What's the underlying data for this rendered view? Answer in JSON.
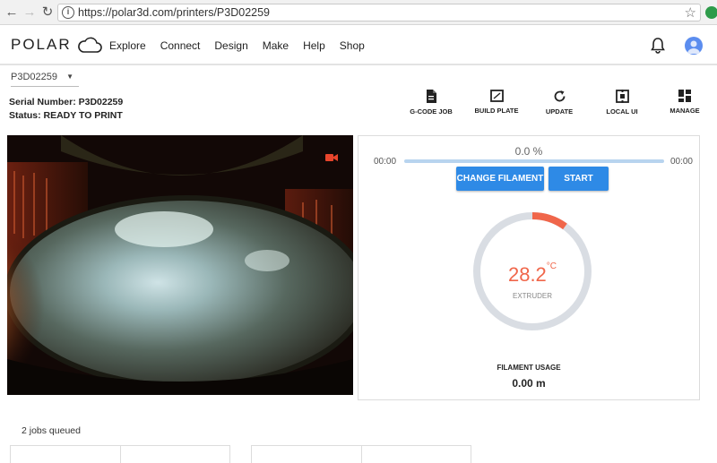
{
  "browser": {
    "url": "https://polar3d.com/printers/P3D02259",
    "back_icon": "arrow-left-icon",
    "forward_icon": "arrow-right-icon",
    "reload_icon": "reload-icon"
  },
  "header": {
    "logo_text": "POLAR",
    "nav": [
      "Explore",
      "Connect",
      "Design",
      "Make",
      "Help",
      "Shop"
    ]
  },
  "printer": {
    "selected": "P3D02259",
    "serial_line": "Serial Number: P3D02259",
    "status_line": "Status: READY TO PRINT"
  },
  "toolbar": {
    "items": [
      "G-CODE JOB",
      "BUILD PLATE",
      "UPDATE",
      "LOCAL UI",
      "MANAGE"
    ]
  },
  "print": {
    "progress_label": "0.0 %",
    "progress_fraction": 0.0,
    "elapsed": "00:00",
    "remaining": "00:00",
    "change_filament_label": "CHANGE FILAMENT",
    "start_label": "START"
  },
  "extruder": {
    "temp_value": "28.2",
    "temp_unit": "°C",
    "label": "EXTRUDER",
    "gauge_fraction": 0.1
  },
  "filament": {
    "label": "FILAMENT USAGE",
    "value": "0.00 m"
  },
  "queue": {
    "label": "2 jobs queued"
  },
  "colors": {
    "accent": "#2e8ae6",
    "temp": "#f0664a",
    "gauge_track": "#d9dde3",
    "cam_icon": "#e8452c"
  }
}
